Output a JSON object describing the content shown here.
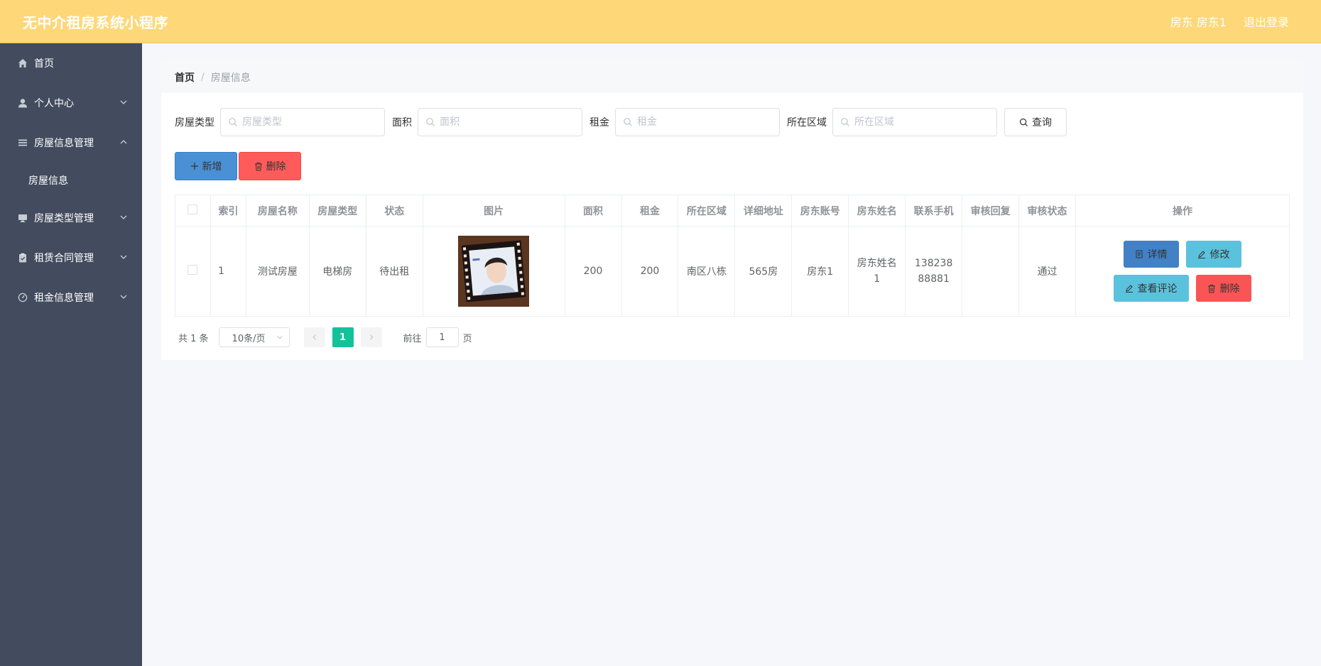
{
  "header": {
    "title": "无中介租房系统小程序",
    "user_label": "房东 房东1",
    "logout": "退出登录"
  },
  "sidebar": {
    "items": [
      {
        "label": "首页",
        "icon": "home-icon"
      },
      {
        "label": "个人中心",
        "icon": "user-icon"
      },
      {
        "label": "房屋信息管理",
        "icon": "list-icon"
      },
      {
        "label": "房屋信息",
        "icon": ""
      },
      {
        "label": "房屋类型管理",
        "icon": "monitor-icon"
      },
      {
        "label": "租赁合同管理",
        "icon": "clipboard-icon"
      },
      {
        "label": "租金信息管理",
        "icon": "gauge-icon"
      }
    ]
  },
  "breadcrumb": {
    "home": "首页",
    "current": "房屋信息"
  },
  "search": {
    "type_label": "房屋类型",
    "type_placeholder": "房屋类型",
    "area_label": "面积",
    "area_placeholder": "面积",
    "rent_label": "租金",
    "rent_placeholder": "租金",
    "region_label": "所在区域",
    "region_placeholder": "所在区域",
    "query_button": "查询"
  },
  "actions": {
    "add": "新增",
    "delete": "删除"
  },
  "table": {
    "headers": [
      "索引",
      "房屋名称",
      "房屋类型",
      "状态",
      "图片",
      "面积",
      "租金",
      "所在区域",
      "详细地址",
      "房东账号",
      "房东姓名",
      "联系手机",
      "审核回复",
      "审核状态",
      "操作"
    ],
    "rows": [
      {
        "index": "1",
        "name": "测试房屋",
        "type": "电梯房",
        "status": "待出租",
        "area": "200",
        "rent": "200",
        "region": "南区八栋",
        "address": "565房",
        "account": "房东1",
        "owner_name": "房东姓名1",
        "phone": "13823888881",
        "review_reply": "",
        "review_status": "通过"
      }
    ],
    "row_buttons": {
      "detail": "详情",
      "edit": "修改",
      "comments": "查看评论",
      "delete": "删除"
    }
  },
  "pagination": {
    "total": "共 1 条",
    "page_size": "10条/页",
    "current_page": "1",
    "goto_label": "前往",
    "goto_value": "1",
    "page_unit": "页"
  },
  "colors": {
    "topbar": "#fed779",
    "sidebar": "#434c5e",
    "primary": "#4a90d4",
    "danger": "#ff5b5b",
    "info": "#5bc2dd",
    "page_active": "#13c29a"
  }
}
